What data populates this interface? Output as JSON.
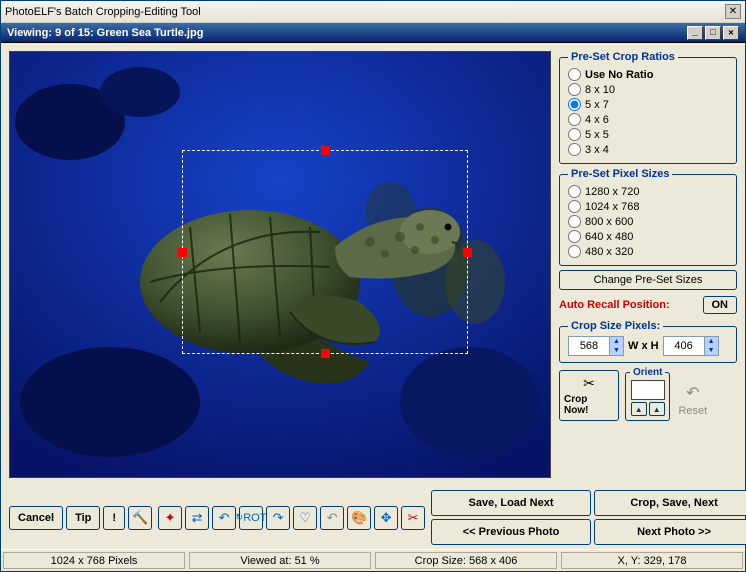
{
  "title": "PhotoELF's Batch Cropping-Editing Tool",
  "viewing_prefix": "Viewing:  ",
  "viewing_value": "9 of 15: Green Sea Turtle.jpg",
  "ratios": {
    "legend": "Pre-Set Crop Ratios",
    "items": [
      "Use No Ratio",
      "8 x 10",
      "5 x 7",
      "4 x 6",
      "5 x 5",
      "3 x 4"
    ],
    "selected": 2
  },
  "pixel_sizes": {
    "legend": "Pre-Set Pixel Sizes",
    "items": [
      "1280 x 720",
      "1024 x 768",
      "800 x 600",
      "640 x 480",
      "480 x 320"
    ],
    "selected": -1
  },
  "change_presets": "Change Pre-Set Sizes",
  "auto_recall": {
    "label": "Auto Recall Position:",
    "state": "ON"
  },
  "crop_size": {
    "legend": "Crop Size Pixels:",
    "w": "568",
    "h": "406",
    "wxh": "W x H"
  },
  "crop_now": "Crop Now!",
  "orient": "Orient",
  "reset": "Reset",
  "toolbar": {
    "cancel": "Cancel",
    "tip": "Tip",
    "bang": "!",
    "save_load_next": "Save, Load Next",
    "crop_save_next": "Crop, Save, Next",
    "prev_photo": "<< Previous Photo",
    "next_photo": "Next Photo >>"
  },
  "status": {
    "dims": "1024 x 768 Pixels",
    "zoom": "Viewed at: 51 %",
    "crop": "Crop Size: 568 x 406",
    "xy": "X, Y: 329, 178"
  }
}
